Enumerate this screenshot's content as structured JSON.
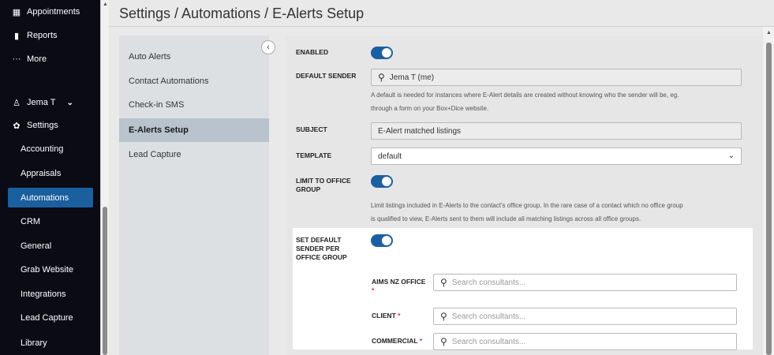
{
  "nav": {
    "top_items": [
      {
        "label": "Appointments",
        "icon": "calendar-icon"
      },
      {
        "label": "Reports",
        "icon": "bar-chart-icon"
      },
      {
        "label": "More",
        "icon": "ellipsis-icon"
      }
    ],
    "user": {
      "label": "Jema T",
      "icon": "user-icon"
    },
    "settings": {
      "label": "Settings",
      "icon": "gear-icon"
    },
    "settings_items": [
      "Accounting",
      "Appraisals",
      "Automations",
      "CRM",
      "General",
      "Grab Website",
      "Integrations",
      "Lead Capture",
      "Library"
    ],
    "active": "Automations"
  },
  "header": {
    "title": "Settings / Automations / E-Alerts Setup"
  },
  "submenu": {
    "items": [
      "Auto Alerts",
      "Contact Automations",
      "Check-in SMS",
      "E-Alerts Setup",
      "Lead Capture"
    ],
    "active": "E-Alerts Setup"
  },
  "form": {
    "enabled_label": "ENABLED",
    "enabled": true,
    "default_sender_label": "DEFAULT SENDER",
    "default_sender_value": "Jema T (me)",
    "default_sender_help_1": "A default is needed for instances where E-Alert details are created without knowing who the sender will be, eg.",
    "default_sender_help_2": "through a form on your Box+Dice website.",
    "subject_label": "SUBJECT",
    "subject_value": "E-Alert matched listings",
    "template_label": "TEMPLATE",
    "template_value": "default",
    "limit_label_1": "LIMIT TO OFFICE",
    "limit_label_2": "GROUP",
    "limit_enabled": true,
    "limit_help_1": "Limit listings included in E-Alerts to the contact's office group. In the rare case of a contact which no office group",
    "limit_help_2": "is qualified to view, E-Alerts sent to them will include all matching listings across all office groups.",
    "per_office_label_1": "SET DEFAULT",
    "per_office_label_2": "SENDER PER",
    "per_office_label_3": "OFFICE GROUP",
    "per_office_enabled": true,
    "offices": [
      {
        "label": "AIMS NZ OFFICE",
        "required": "*",
        "placeholder": "Search consultants..."
      },
      {
        "label": "CLIENT",
        "required": "*",
        "placeholder": "Search consultants..."
      },
      {
        "label": "COMMERCIAL",
        "required": "*",
        "placeholder": "Search consultants..."
      }
    ]
  },
  "colors": {
    "accent": "#1b5fa3",
    "nav_bg": "#0b0b16",
    "active_nav": "#1a5f9e"
  }
}
